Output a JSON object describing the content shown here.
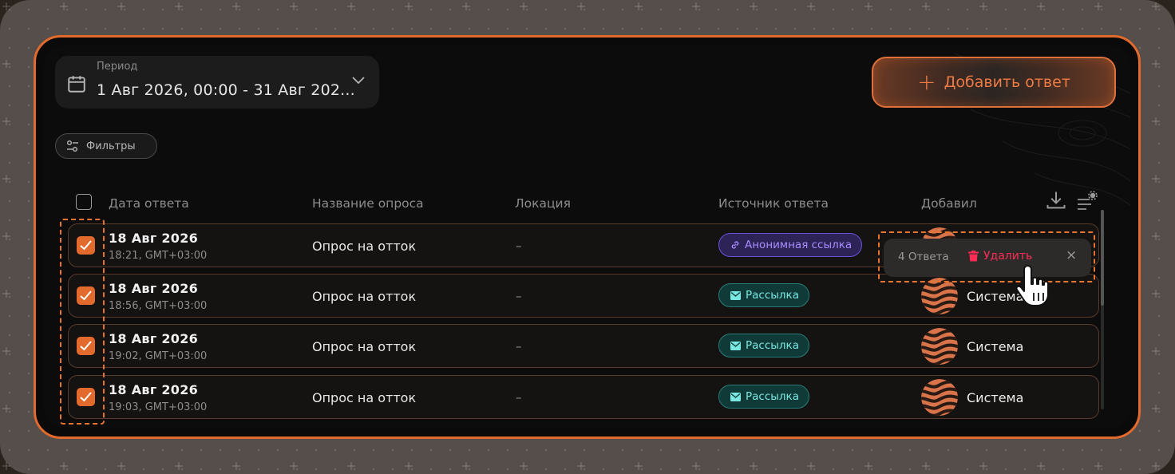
{
  "period": {
    "label": "Период",
    "value": "1 Авг 2026, 00:00 - 31 Авг 202..."
  },
  "add_button": {
    "label": "Добавить ответ"
  },
  "filters": {
    "label": "Фильтры"
  },
  "table": {
    "headers": {
      "date": "Дата ответа",
      "survey": "Название опроса",
      "location": "Локация",
      "source": "Источник ответа",
      "added_by": "Добавил"
    },
    "rows": [
      {
        "date": "18 Авг 2026",
        "time": "18:21, GMT+03:00",
        "survey": "Опрос на отток",
        "location": "–",
        "source": "Анонимная ссылка",
        "source_type": "link",
        "added_by": "",
        "checked": true
      },
      {
        "date": "18 Авг 2026",
        "time": "18:56, GMT+03:00",
        "survey": "Опрос на отток",
        "location": "–",
        "source": "Рассылка",
        "source_type": "mail",
        "added_by": "Система",
        "checked": true
      },
      {
        "date": "18 Авг 2026",
        "time": "19:02, GMT+03:00",
        "survey": "Опрос на отток",
        "location": "–",
        "source": "Рассылка",
        "source_type": "mail",
        "added_by": "Система",
        "checked": true
      },
      {
        "date": "18 Авг 2026",
        "time": "19:03, GMT+03:00",
        "survey": "Опрос на отток",
        "location": "–",
        "source": "Рассылка",
        "source_type": "mail",
        "added_by": "Система",
        "checked": true
      }
    ]
  },
  "selection_popup": {
    "count": "4 Ответа",
    "delete_label": "Удалить",
    "close": "×"
  },
  "colors": {
    "accent": "#e26a2c",
    "delete": "#ff2d55",
    "mail_badge": "#7ae8e0",
    "link_badge": "#a78bff"
  },
  "icons": [
    "calendar-icon",
    "chevron-down-icon",
    "plus-icon",
    "sliders-icon",
    "download-icon",
    "column-settings-icon",
    "check-icon",
    "link-icon",
    "mail-icon",
    "trash-icon",
    "close-icon",
    "hand-cursor-icon"
  ]
}
